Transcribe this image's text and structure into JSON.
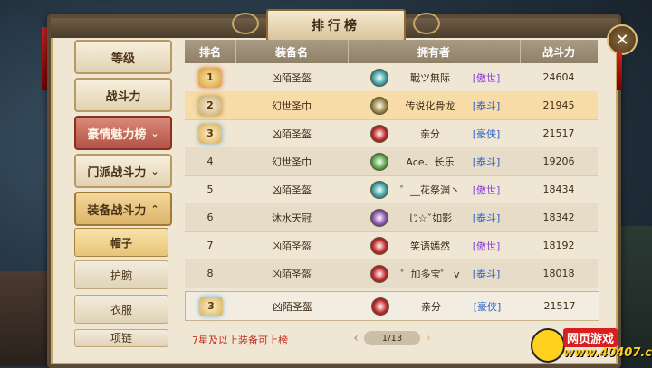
{
  "window": {
    "title": "排行榜",
    "close_label": "✕"
  },
  "sidebar": {
    "items": [
      {
        "label": "等级"
      },
      {
        "label": "战斗力"
      },
      {
        "label": "豪情魅力榜",
        "chevron": "⌄"
      },
      {
        "label": "门派战斗力",
        "chevron": "⌄"
      },
      {
        "label": "装备战斗力",
        "chevron": "⌃"
      }
    ],
    "subitems": [
      {
        "label": "帽子"
      },
      {
        "label": "护腕"
      },
      {
        "label": "衣服"
      },
      {
        "label": "项链"
      }
    ]
  },
  "table": {
    "headers": [
      "排名",
      "装备名",
      "拥有者",
      "战斗力"
    ],
    "rows": [
      {
        "rank": "1",
        "item": "凶陌圣盔",
        "owner": "戰ツ無际",
        "tag": "[傲世]",
        "tag_color": "#8b3fd6",
        "power": "24604",
        "icon_color": "#3aa4a8"
      },
      {
        "rank": "2",
        "item": "幻世圣巾",
        "owner": "传说化骨龙",
        "tag": "[泰斗]",
        "tag_color": "#2a5ec8",
        "power": "21945",
        "icon_color": "#9a8a45"
      },
      {
        "rank": "3",
        "item": "凶陌圣盔",
        "owner": "亲分",
        "tag": "[豪侠]",
        "tag_color": "#2a5ec8",
        "power": "21517",
        "icon_color": "#c0282a"
      },
      {
        "rank": "4",
        "item": "幻世圣巾",
        "owner": "Ace、长乐",
        "tag": "[泰斗]",
        "tag_color": "#2a5ec8",
        "power": "19206",
        "icon_color": "#5aa84a"
      },
      {
        "rank": "5",
        "item": "凶陌圣盔",
        "owner": "゜__花祭渊丶",
        "tag": "[傲世]",
        "tag_color": "#8b3fd6",
        "power": "18434",
        "icon_color": "#3aa4a8"
      },
      {
        "rank": "6",
        "item": "沐水天冠",
        "owner": "じ☆ˇ如影",
        "tag": "[泰斗]",
        "tag_color": "#2a5ec8",
        "power": "18342",
        "icon_color": "#8a55b0"
      },
      {
        "rank": "7",
        "item": "凶陌圣盔",
        "owner": "笑语嫣然",
        "tag": "[傲世]",
        "tag_color": "#8b3fd6",
        "power": "18192",
        "icon_color": "#c0282a"
      },
      {
        "rank": "8",
        "item": "凶陌圣盔",
        "owner": "゜加多宝゜ v",
        "tag": "[泰斗]",
        "tag_color": "#2a5ec8",
        "power": "18018",
        "icon_color": "#c0282a"
      }
    ],
    "self_row": {
      "rank": "3",
      "item": "凶陌圣盔",
      "owner": "亲分",
      "tag": "[豪侠]",
      "tag_color": "#2a5ec8",
      "power": "21517",
      "icon_color": "#c0282a"
    }
  },
  "footer": {
    "note": "7星及以上装备可上榜",
    "page": "1/13",
    "prev": "‹",
    "next": "›"
  },
  "watermark": {
    "line1": "网页游戏",
    "line2": "www.40407.com"
  }
}
